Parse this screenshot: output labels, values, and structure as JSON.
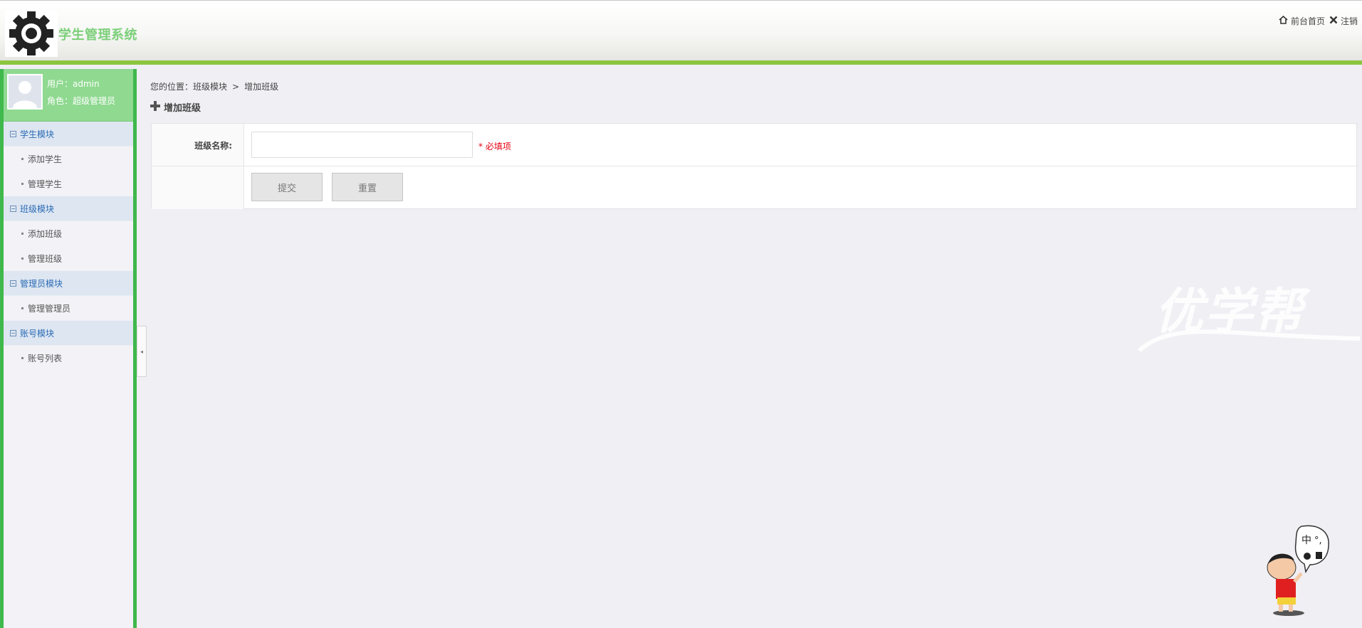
{
  "header": {
    "site_title": "学生管理系统",
    "links": [
      {
        "label": "前台首页",
        "icon": "home-icon"
      },
      {
        "label": "注销",
        "icon": "close-icon"
      }
    ]
  },
  "sidebar": {
    "user": {
      "line1": "用户：admin",
      "line2": "角色：超级管理员"
    },
    "groups": [
      {
        "title": "学生模块",
        "items": [
          "添加学生",
          "管理学生"
        ]
      },
      {
        "title": "班级模块",
        "items": [
          "添加班级",
          "管理班级"
        ]
      },
      {
        "title": "管理员模块",
        "items": [
          "管理管理员"
        ]
      },
      {
        "title": "账号模块",
        "items": [
          "账号列表"
        ]
      }
    ]
  },
  "breadcrumb": {
    "prefix": "您的位置：",
    "level1": "班级模块",
    "separator": ">",
    "level2": "增加班级"
  },
  "page": {
    "heading": "增加班级",
    "form": {
      "name_label": "班级名称:",
      "name_value": "",
      "required_note": "* 必填项",
      "submit_label": "提交",
      "reset_label": "重置"
    }
  },
  "watermark": {
    "text": "优学帮"
  },
  "colors": {
    "accent_green": "#8cc63f",
    "sidebar_border": "#3fb84c",
    "title_green": "#7ccf7a",
    "menu_blue": "#2b6bb5",
    "required_red": "#e60012"
  }
}
